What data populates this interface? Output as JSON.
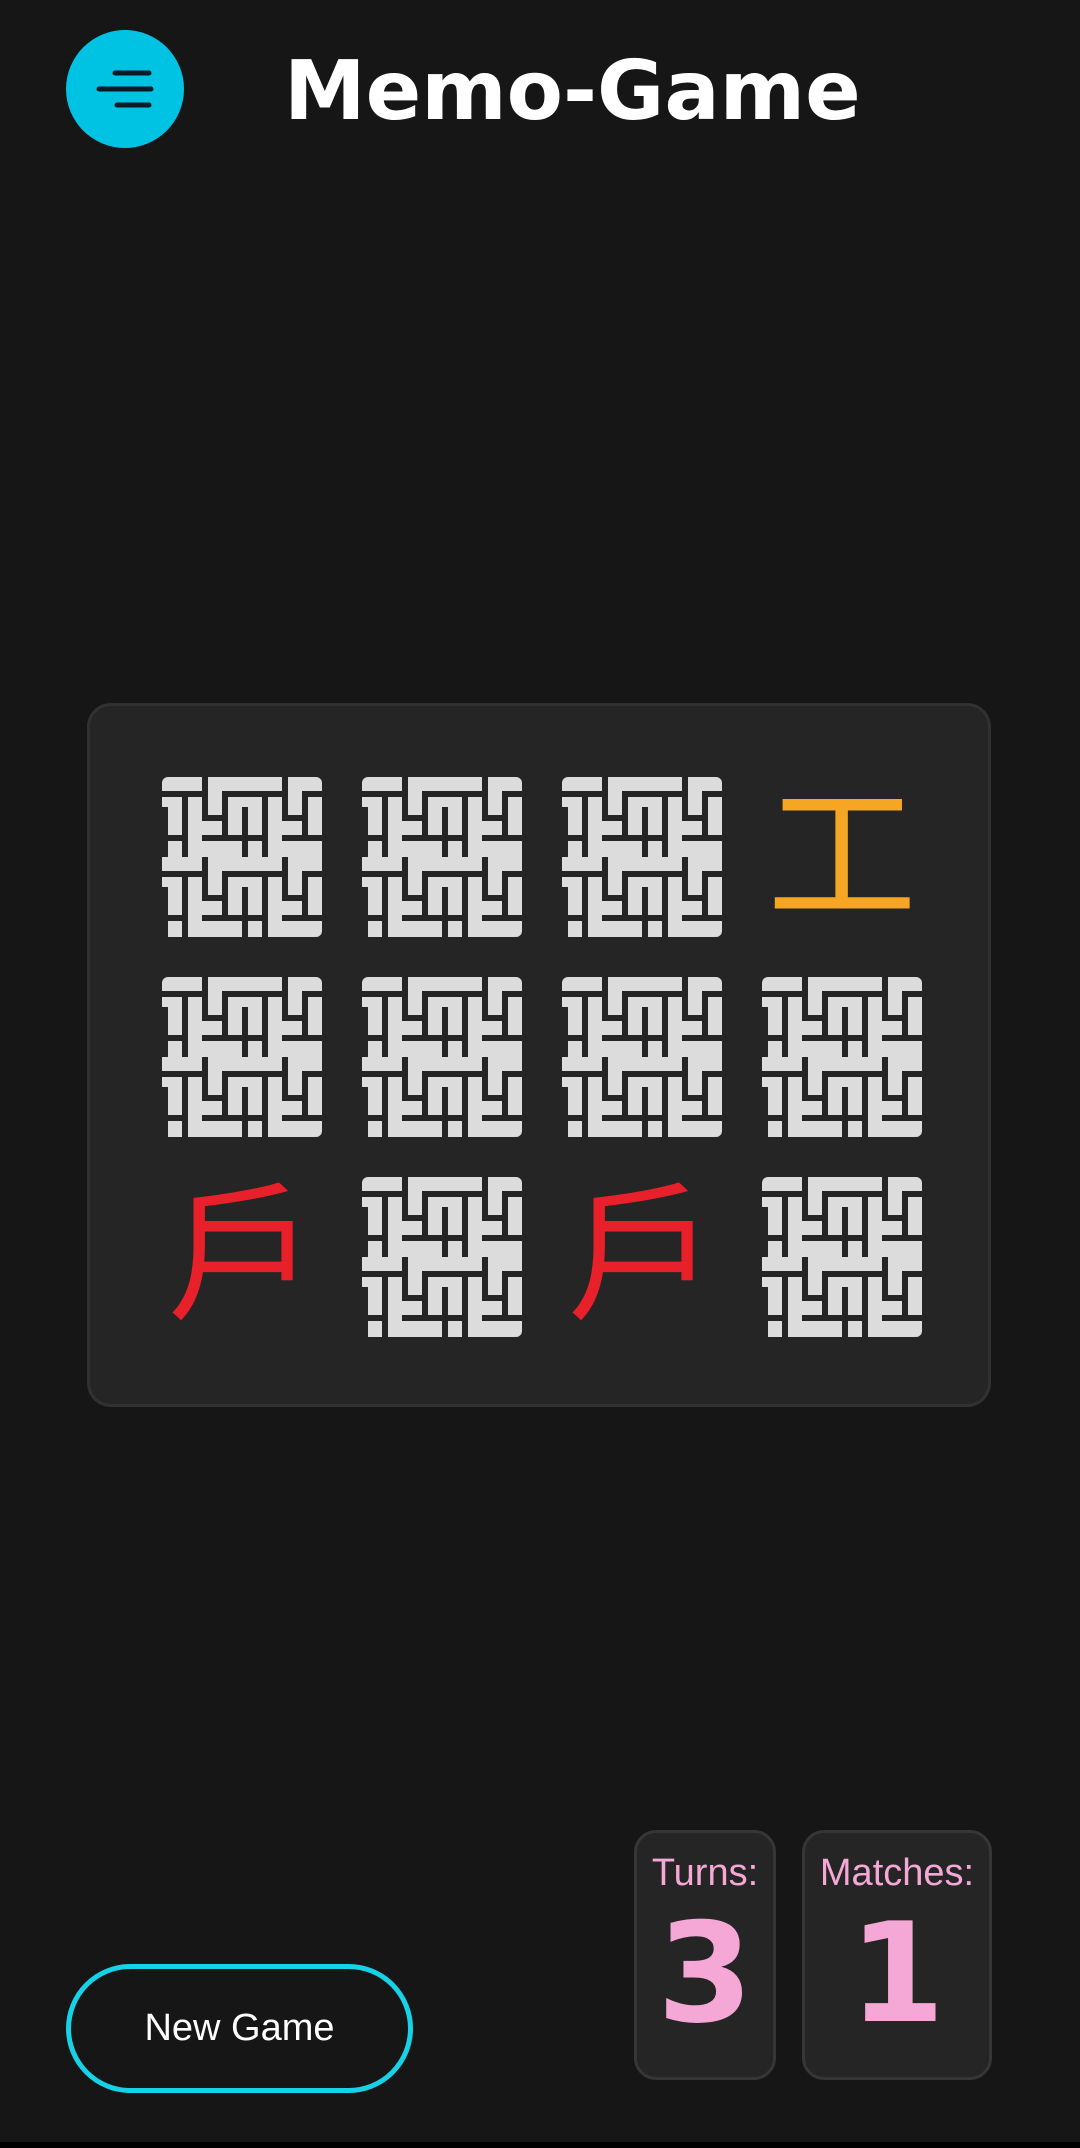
{
  "header": {
    "title": "Memo-Game",
    "menu_icon": "menu-lines-icon",
    "accent_color": "#00c3e3"
  },
  "board": {
    "rows": 3,
    "columns": 4,
    "cards": [
      {
        "state": "hidden",
        "face": "pattern-back-icon"
      },
      {
        "state": "hidden",
        "face": "pattern-back-icon"
      },
      {
        "state": "hidden",
        "face": "pattern-back-icon"
      },
      {
        "state": "revealed",
        "symbol": "工",
        "color": "#f6a623"
      },
      {
        "state": "hidden",
        "face": "pattern-back-icon"
      },
      {
        "state": "hidden",
        "face": "pattern-back-icon"
      },
      {
        "state": "hidden",
        "face": "pattern-back-icon"
      },
      {
        "state": "hidden",
        "face": "pattern-back-icon"
      },
      {
        "state": "revealed",
        "symbol": "戶",
        "color": "#e8202a"
      },
      {
        "state": "hidden",
        "face": "pattern-back-icon"
      },
      {
        "state": "revealed",
        "symbol": "戶",
        "color": "#e8202a"
      },
      {
        "state": "hidden",
        "face": "pattern-back-icon"
      }
    ]
  },
  "controls": {
    "new_game_label": "New Game",
    "new_game_border_color": "#16d2e6"
  },
  "stats": {
    "turns_label": "Turns:",
    "turns_value": "3",
    "matches_label": "Matches:",
    "matches_value": "1",
    "text_color": "#f5a8d6"
  }
}
